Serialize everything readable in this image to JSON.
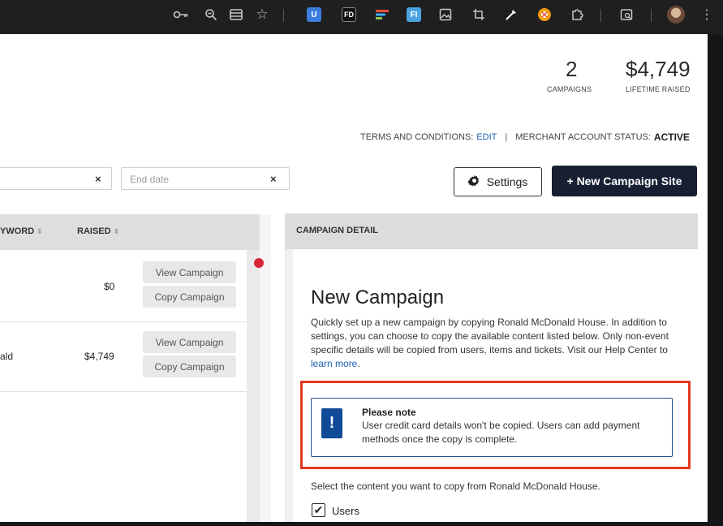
{
  "browser": {
    "icons": [
      "key-icon",
      "zoom-icon",
      "reader-mode-icon",
      "bookmark-star-icon",
      "ext-u-icon",
      "ext-fd-icon",
      "ext-colorful-icon",
      "ext-fi-icon",
      "ext-image-icon",
      "ext-crop-icon",
      "ext-picker-icon",
      "ext-orange-icon",
      "extensions-puzzle-icon",
      "tab-search-icon",
      "profile-avatar-icon",
      "menu-icon"
    ],
    "ext_u": "U",
    "ext_fd": "FD",
    "ext_fi": "FI"
  },
  "stats": {
    "campaigns_value": "2",
    "campaigns_label": "CAMPAIGNS",
    "raised_value": "$4,749",
    "raised_label": "LIFETIME RAISED"
  },
  "status": {
    "terms_label": "TERMS AND CONDITIONS:",
    "terms_action": "EDIT",
    "merchant_label": "MERCHANT ACCOUNT STATUS:",
    "merchant_value": "ACTIVE"
  },
  "filters": {
    "start_clear": "×",
    "end_placeholder": "End date",
    "end_clear": "×"
  },
  "actions": {
    "settings_label": "Settings",
    "new_campaign_label": "+ New Campaign Site"
  },
  "table": {
    "headers": [
      "YWORD",
      "RAISED"
    ],
    "sort_glyph": "⬍",
    "rows": [
      {
        "name": "",
        "raised": "$0",
        "view": "View Campaign",
        "copy": "Copy Campaign"
      },
      {
        "name": "ald",
        "raised": "$4,749",
        "view": "View Campaign",
        "copy": "Copy Campaign"
      }
    ]
  },
  "detail": {
    "header": "CAMPAIGN DETAIL",
    "title": "New Campaign",
    "description": "Quickly set up a new campaign by copying Ronald McDonald House. In addition to settings, you can choose to copy the available content listed below. Only non-event specific details will be copied from users, items and tickets. Visit our Help Center to",
    "link": "learn more",
    "link_suffix": ".",
    "note_title": "Please note",
    "note_body": "User credit card details won't be copied. Users can add payment methods once the copy is complete.",
    "note_icon": "!",
    "select_prompt": "Select the content you want to copy from Ronald McDonald House.",
    "checkbox_label": "Users",
    "checkbox_checked": true
  }
}
